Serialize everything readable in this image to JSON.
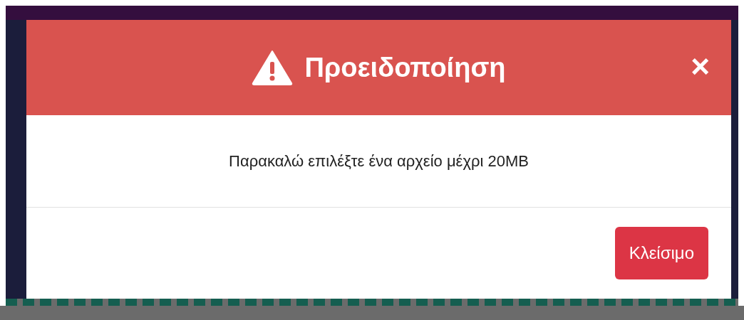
{
  "dialog": {
    "title": "Προειδοποίηση",
    "message": "Παρακαλώ επιλέξτε ένα αρχείο μέχρι 20MB",
    "close_icon": "×",
    "buttons": [
      "Κλείσιμο"
    ]
  }
}
